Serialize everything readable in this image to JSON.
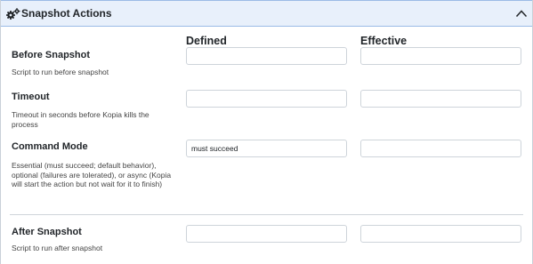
{
  "section": {
    "title": "Snapshot Actions",
    "icon": "gears-icon",
    "toggle_icon": "chevron-up-icon"
  },
  "columns": {
    "defined": "Defined",
    "effective": "Effective"
  },
  "rows": [
    {
      "label": "Before Snapshot",
      "help": "Script to run before snapshot",
      "defined_value": "",
      "effective_value": ""
    },
    {
      "label": "Timeout",
      "help": "Timeout in seconds before Kopia kills the process",
      "defined_value": "",
      "effective_value": ""
    },
    {
      "label": "Command Mode",
      "help": "Essential (must succeed; default behavior), optional (failures are tolerated), or async (Kopia will start the action but not wait for it to finish)",
      "defined_value": "must succeed",
      "effective_value": ""
    },
    {
      "label": "After Snapshot",
      "help": "Script to run after snapshot",
      "defined_value": "",
      "effective_value": ""
    }
  ],
  "colors": {
    "header_bg": "#e8f0fb",
    "header_border": "#9bbbe6",
    "input_border": "#ced4da"
  }
}
